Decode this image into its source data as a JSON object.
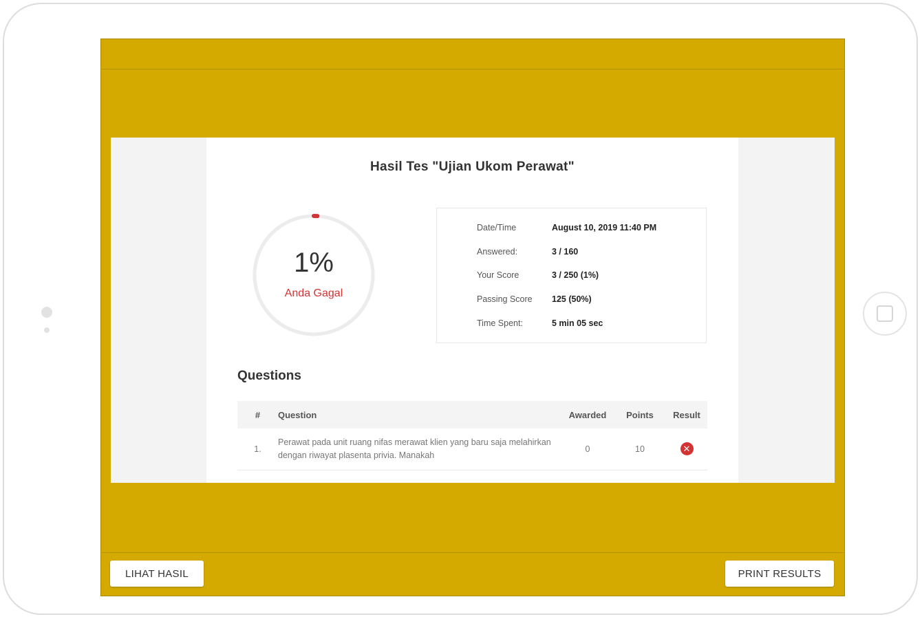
{
  "result": {
    "title": "Hasil Tes \"Ujian Ukom Perawat\"",
    "percent_label": "1%",
    "percent_value": 1,
    "status_label": "Anda Gagal"
  },
  "stats": {
    "rows": [
      {
        "label": "Date/Time",
        "value": "August 10, 2019 11:40 PM"
      },
      {
        "label": "Answered:",
        "value": "3 / 160"
      },
      {
        "label": "Your Score",
        "value": "3 / 250 (1%)"
      },
      {
        "label": "Passing Score",
        "value": "125 (50%)"
      },
      {
        "label": "Time Spent:",
        "value": "5 min 05 sec"
      }
    ]
  },
  "questions": {
    "heading": "Questions",
    "columns": {
      "num": "#",
      "question": "Question",
      "awarded": "Awarded",
      "points": "Points",
      "result": "Result"
    },
    "rows": [
      {
        "num": "1.",
        "question": "Perawat pada unit ruang nifas merawat klien yang baru saja melahirkan dengan riwayat plasenta privia. Manakah",
        "awarded": "0",
        "points": "10",
        "result_icon": "x-circle-icon"
      }
    ]
  },
  "buttons": {
    "left": "LIHAT HASIL",
    "right": "PRINT RESULTS"
  },
  "colors": {
    "background_accent": "#d4aa00",
    "fail": "#d33333"
  }
}
